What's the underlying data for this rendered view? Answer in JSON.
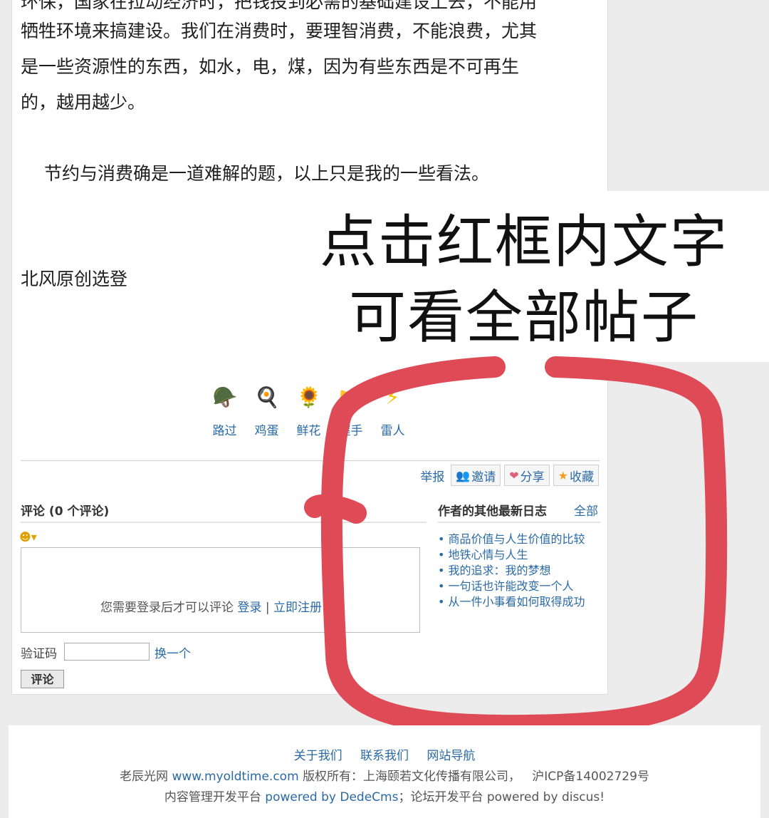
{
  "article": {
    "lines": [
      "环保，国家在拉动经济时，把钱投到必需的基础建设上去，不能用",
      "牺牲环境来搞建设。我们在消费时，要理智消费，不能浪费，尤其",
      "是一些资源性的东西，如水，电，煤，因为有些东西是不可再生",
      "的，越用越少。",
      "节约与消费确是一道难解的题，以上只是我的一些看法。"
    ],
    "signature": "北风原创选登"
  },
  "reactions": [
    {
      "label": "路过",
      "icon": "soldier-icon"
    },
    {
      "label": "鸡蛋",
      "icon": "egg-icon"
    },
    {
      "label": "鲜花",
      "icon": "flower-icon"
    },
    {
      "label": "握手",
      "icon": "handshake-icon"
    },
    {
      "label": "雷人",
      "icon": "lightning-icon"
    }
  ],
  "actions": {
    "report": "举报",
    "invite": "邀请",
    "share": "分享",
    "favorite": "收藏"
  },
  "comments": {
    "title": "评论",
    "count": "(0 个评论)",
    "login_note": "您需要登录后才可以评论",
    "login_link": "登录",
    "separator": "|",
    "register_link": "立即注册",
    "captcha_label": "验证码",
    "captcha_value": "",
    "captcha_change": "换一个",
    "submit": "评论"
  },
  "other_posts": {
    "title": "作者的其他最新日志",
    "all": "全部",
    "items": [
      "商品价值与人生价值的比较",
      "地铁心情与人生",
      "我的追求：我的梦想",
      "一句话也许能改变一个人",
      "从一件小事看如何取得成功"
    ]
  },
  "overlay": {
    "line1": "点击红框内文字",
    "line2": "可看全部帖子"
  },
  "footer": {
    "links": [
      "关于我们",
      "联系我们",
      "网站导航"
    ],
    "site_name": "老辰光网",
    "site_url": "www.myoldtime.com",
    "copyright": "版权所有：上海颐若文化传播有限公司，",
    "icp": "沪ICP备14002729号",
    "cms_prefix": "内容管理开发平台",
    "cms_link": "powered by DedeCms",
    "forum_prefix": "；论坛开发平台",
    "forum_text": "powered by discus!"
  },
  "colors": {
    "link": "#2a6aa6",
    "annotation_red": "#de4a55"
  }
}
